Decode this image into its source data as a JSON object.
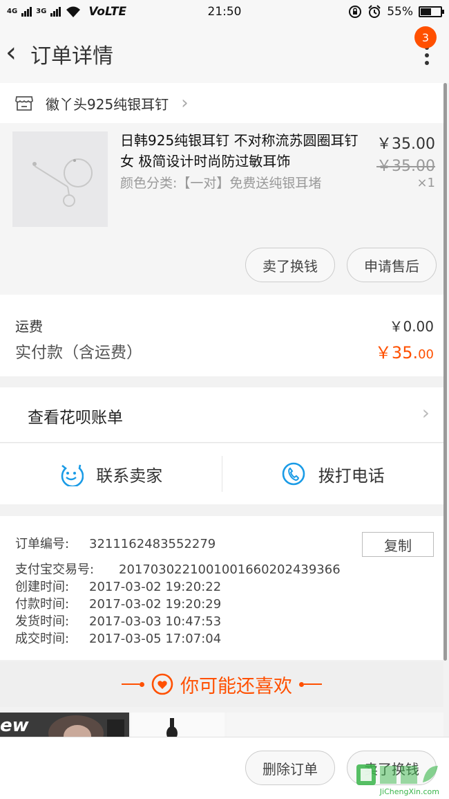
{
  "status_bar": {
    "signal_1": "4G",
    "signal_2": "3G",
    "network": "VoLTE",
    "time": "21:50",
    "battery_percent": "55%",
    "battery_level": 0.55
  },
  "nav": {
    "title": "订单详情",
    "badge_count": "3"
  },
  "shop": {
    "name": "徽丫头925纯银耳钉"
  },
  "item": {
    "title": "日韩925纯银耳钉 不对称流苏圆圈耳钉女 极简设计时尚防过敏耳饰",
    "sku": "颜色分类:【一对】免费送纯银耳堵",
    "price": "￥35.00",
    "original_price": "￥35.00",
    "quantity": "×1",
    "actions": [
      "卖了换钱",
      "申请售后"
    ]
  },
  "fees": {
    "shipping_label": "运费",
    "shipping_value": "￥0.00",
    "paid_label": "实付款（含运费）",
    "paid_int": "￥35.",
    "paid_dec": "00"
  },
  "huabei": {
    "label": "查看花呗账单"
  },
  "contact": {
    "seller_label": "联系卖家",
    "phone_label": "拨打电话"
  },
  "order_info": {
    "copy_label": "复制",
    "lines": [
      {
        "label": "订单编号:",
        "value": "3211162483552279"
      },
      {
        "label": "支付宝交易号:",
        "value": "2017030221001001660202439366"
      },
      {
        "label": "创建时间:",
        "value": "2017-03-02 19:20:22"
      },
      {
        "label": "付款时间:",
        "value": "2017-03-02 19:20:29"
      },
      {
        "label": "发货时间:",
        "value": "2017-03-03 10:47:53"
      },
      {
        "label": "成交时间:",
        "value": "2017-03-05 17:07:04"
      }
    ]
  },
  "recommend": {
    "title": "你可能还喜欢",
    "tile_text": "ew"
  },
  "bottom_bar": {
    "delete_label": "删除订单",
    "sell_label": "卖了换钱"
  },
  "watermark": {
    "text": "JiChengXin.com"
  },
  "colors": {
    "accent": "#ff5000",
    "contact_blue": "#1a9be6"
  }
}
